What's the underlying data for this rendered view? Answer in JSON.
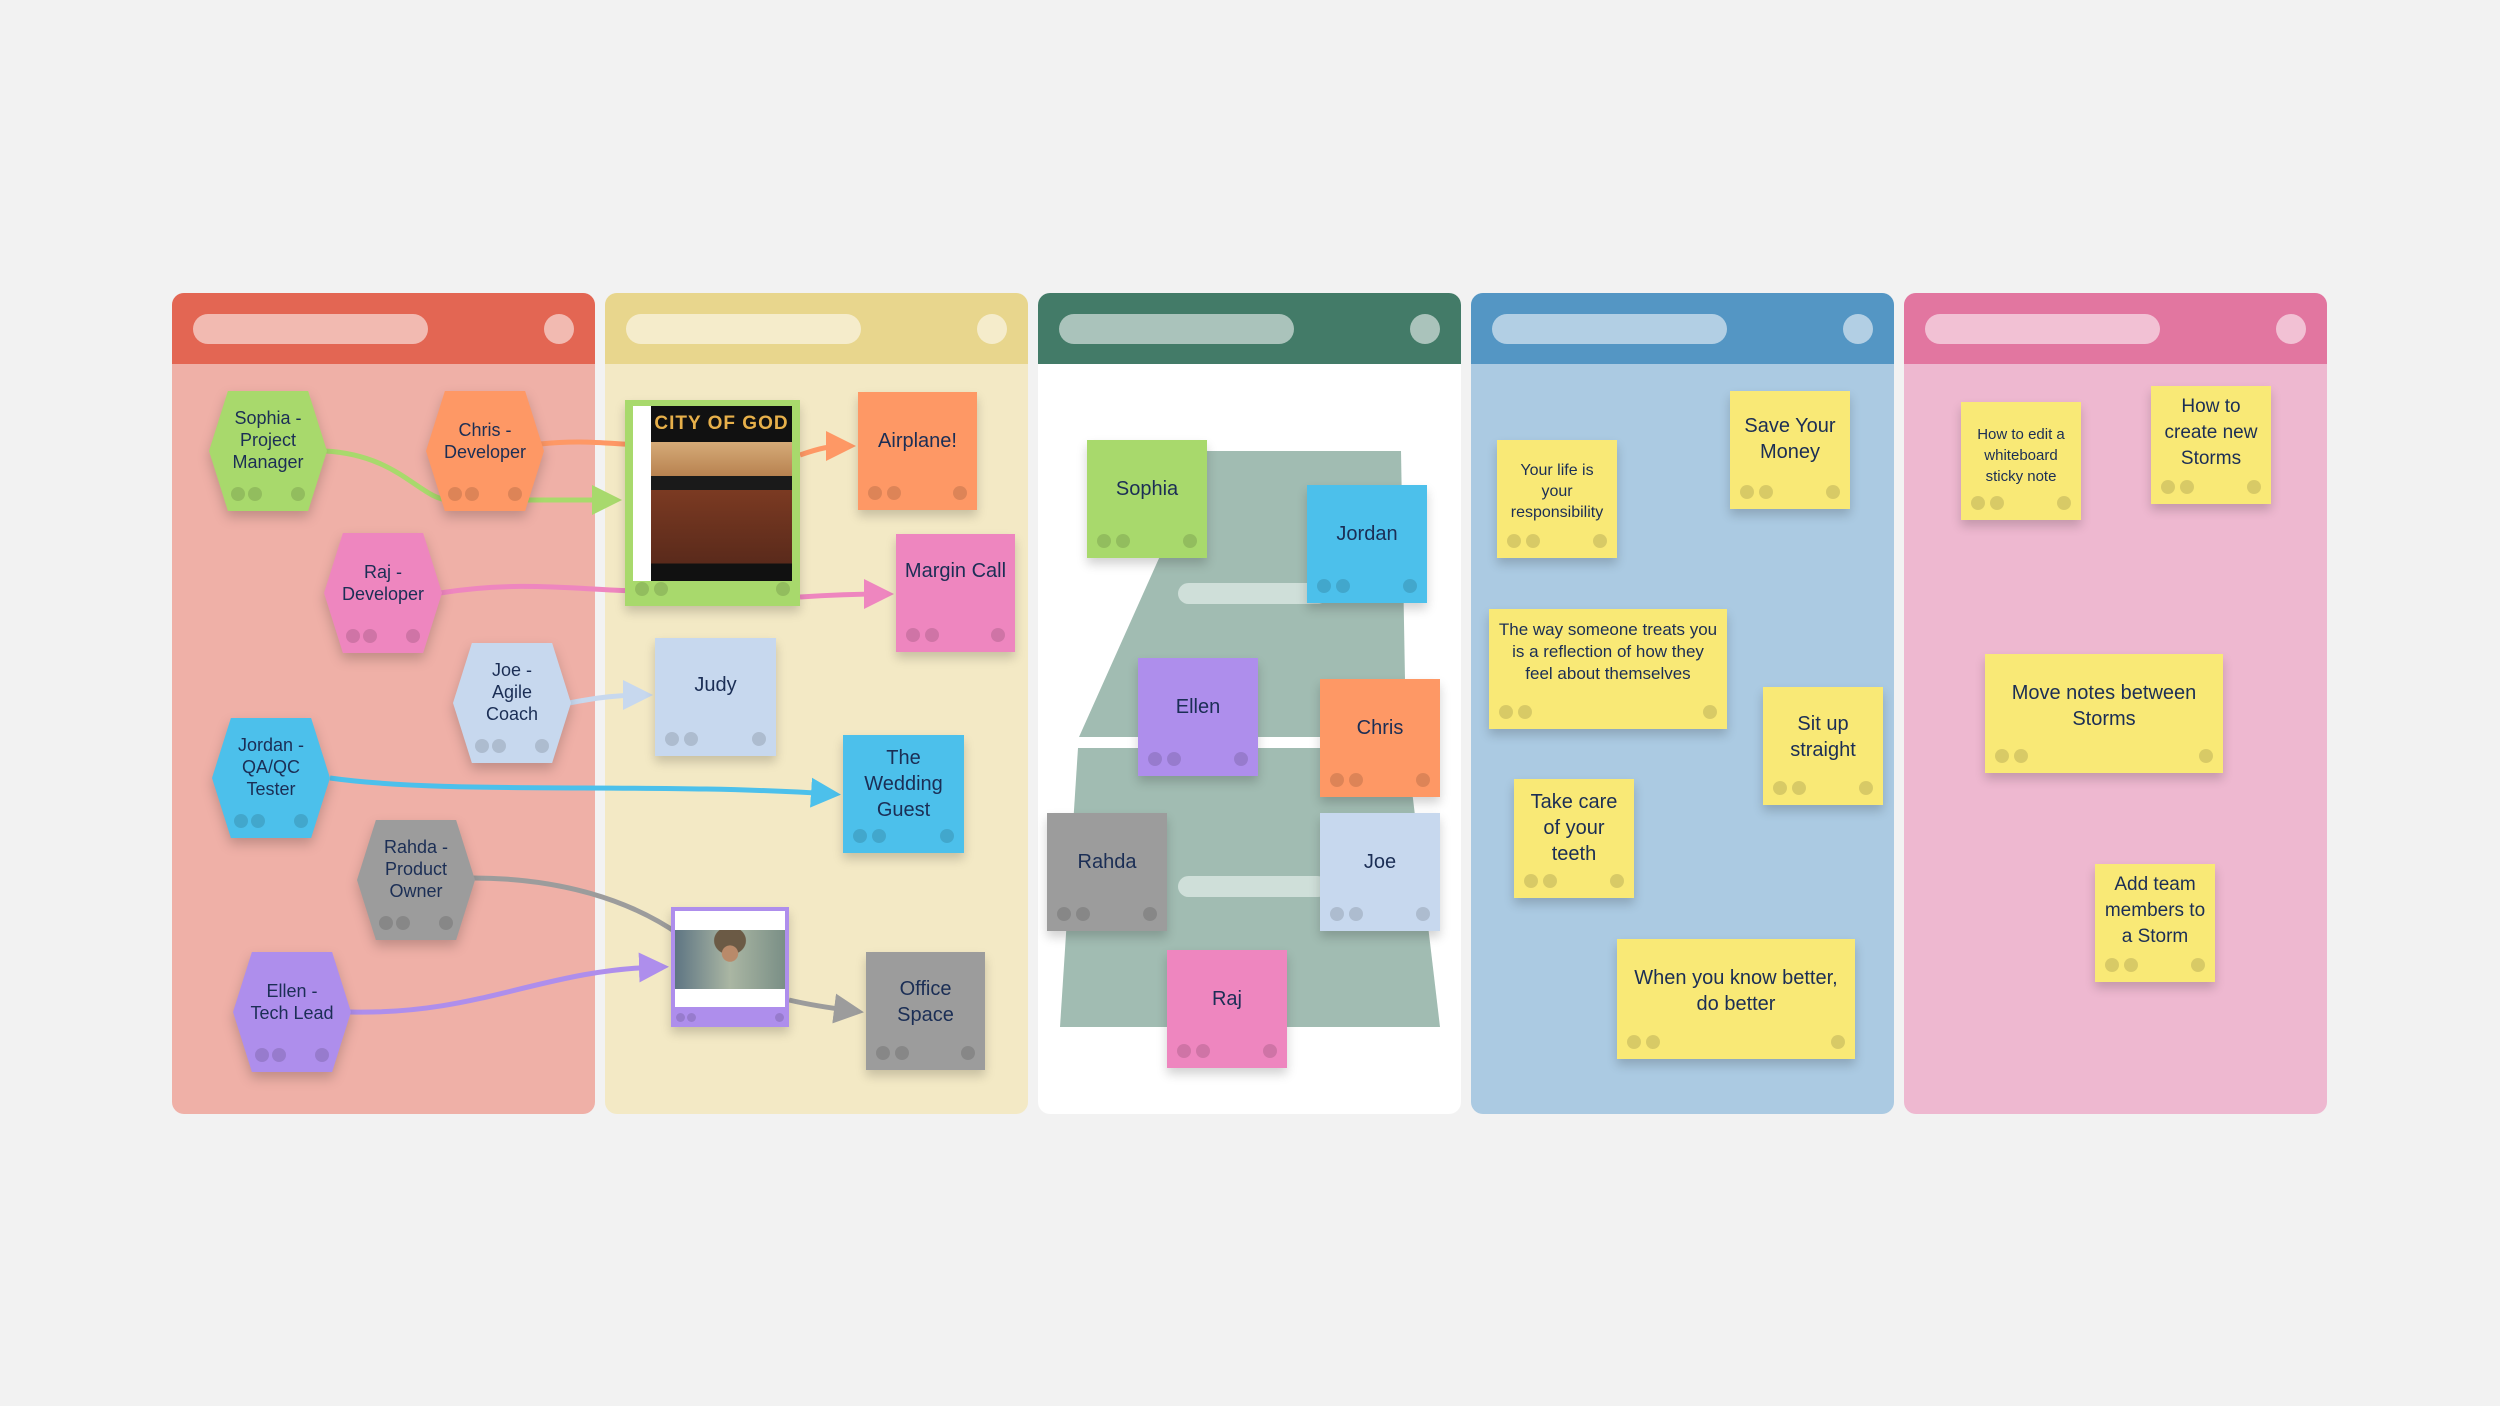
{
  "panels": [
    {
      "name": "roles",
      "header_color": "#e36653",
      "body_color": "#efb0a7"
    },
    {
      "name": "movies",
      "header_color": "#e8d68d",
      "body_color": "#f3e9c5"
    },
    {
      "name": "team-layout",
      "header_color": "#437b68",
      "body_color": "#ffffff"
    },
    {
      "name": "life-tips",
      "header_color": "#5496c4",
      "body_color": "#abcae2"
    },
    {
      "name": "help",
      "header_color": "#e276a0",
      "body_color": "#eeb8d0"
    }
  ],
  "roles": [
    {
      "id": "sophia",
      "label": "Sophia - Project Manager",
      "lines": [
        "Sophia -",
        "Project",
        "Manager"
      ],
      "color": "#a8d96c"
    },
    {
      "id": "chris",
      "label": "Chris - Developer",
      "lines": [
        "Chris -",
        "Developer"
      ],
      "color": "#fe9865"
    },
    {
      "id": "raj",
      "label": "Raj - Developer",
      "lines": [
        "Raj -",
        "Developer"
      ],
      "color": "#ee86bf"
    },
    {
      "id": "joe",
      "label": "Joe - Agile Coach",
      "lines": [
        "Joe -",
        "Agile",
        "Coach"
      ],
      "color": "#c7d8ee"
    },
    {
      "id": "jordan",
      "label": "Jordan - QA/QC Tester",
      "lines": [
        "Jordan -",
        "QA/QC",
        "Tester"
      ],
      "color": "#4cc0eb"
    },
    {
      "id": "rahda",
      "label": "Rahda - Product Owner",
      "lines": [
        "Rahda -",
        "Product",
        "Owner"
      ],
      "color": "#9c9c9c"
    },
    {
      "id": "ellen",
      "label": "Ellen - Tech Lead",
      "lines": [
        "Ellen -",
        "Tech Lead"
      ],
      "color": "#ae8eec"
    }
  ],
  "movies": {
    "city_of_god": {
      "title": "CITY OF GOD",
      "border_color": "#a8d96c"
    },
    "airplane": {
      "text": "Airplane!",
      "color": "#fe9865"
    },
    "margin_call": {
      "text": "Margin Call",
      "color": "#ee86bf"
    },
    "judy": {
      "text": "Judy",
      "color": "#c7d8ee"
    },
    "wedding_guest": {
      "text": "The Wedding Guest",
      "color": "#4cc0eb"
    },
    "indy": {
      "border_color": "#ae8eec"
    },
    "office_space": {
      "text": "Office Space",
      "color": "#9c9c9c"
    }
  },
  "team": [
    {
      "id": "sophia",
      "text": "Sophia",
      "color": "#a8d96c"
    },
    {
      "id": "jordan",
      "text": "Jordan",
      "color": "#4cc0eb"
    },
    {
      "id": "ellen",
      "text": "Ellen",
      "color": "#ae8eec"
    },
    {
      "id": "chris",
      "text": "Chris",
      "color": "#fe9865"
    },
    {
      "id": "rahda",
      "text": "Rahda",
      "color": "#9c9c9c"
    },
    {
      "id": "joe",
      "text": "Joe",
      "color": "#c7d8ee"
    },
    {
      "id": "raj",
      "text": "Raj",
      "color": "#ee86bf"
    }
  ],
  "tips": [
    {
      "text": "Your life is your responsibility"
    },
    {
      "text": "Save Your Money"
    },
    {
      "text": "The way someone treats you is a reflection of how they feel about themselves"
    },
    {
      "text": "Sit up straight"
    },
    {
      "text": "Take care of your teeth"
    },
    {
      "text": "When you know better, do better"
    }
  ],
  "help": [
    {
      "text": "How to edit a whiteboard sticky note"
    },
    {
      "text": "How to create new Storms"
    },
    {
      "text": "Move notes between Storms"
    },
    {
      "text": "Add team members to a Storm"
    }
  ],
  "colors": {
    "sticky_yellow": "#f9e976",
    "text": "#1b2e55",
    "trapezoid": "#a1bcb2"
  }
}
